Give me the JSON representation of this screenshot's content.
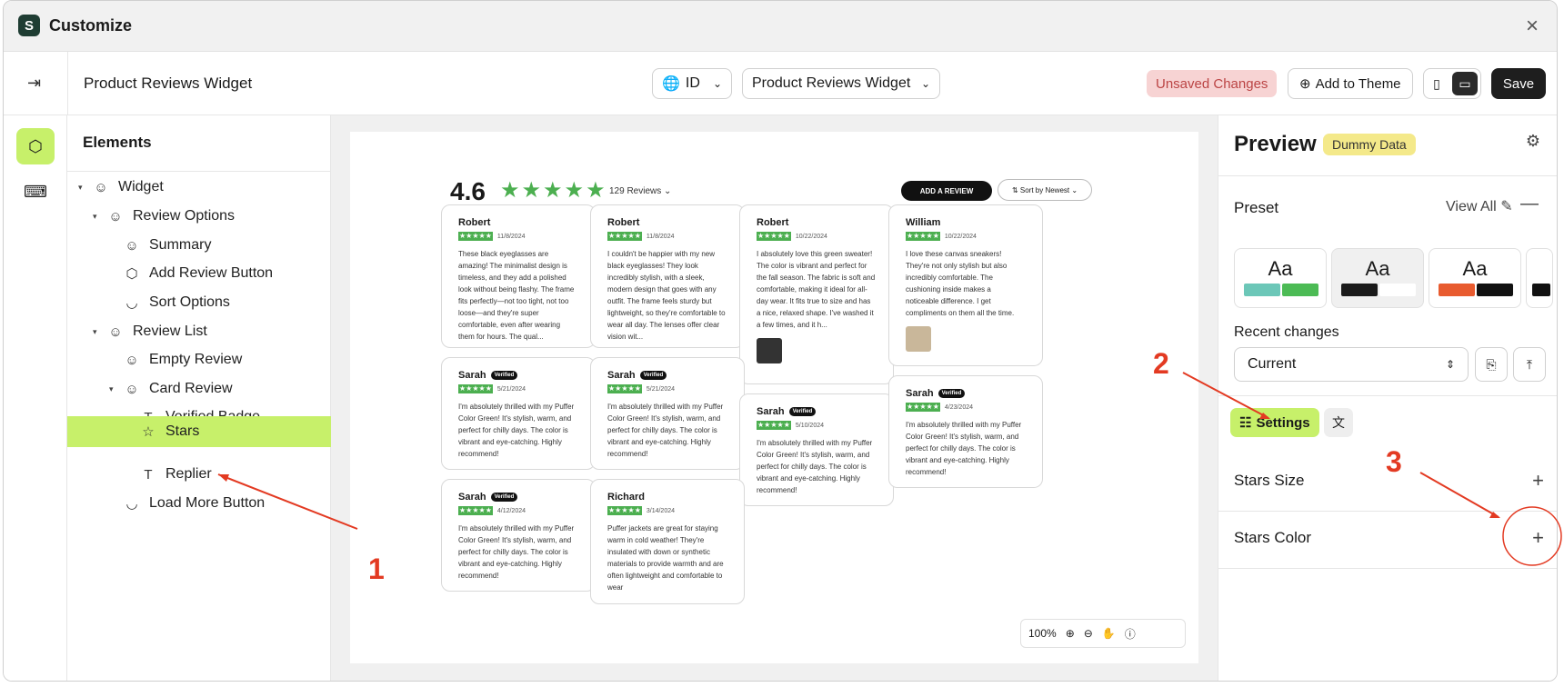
{
  "window": {
    "title": "Customize",
    "close_glyph": "×"
  },
  "topbar": {
    "page_name": "Product Reviews Widget",
    "language": "ID",
    "widget_select": "Product Reviews Widget",
    "unsaved": "Unsaved Changes",
    "add_to_theme": "Add to Theme",
    "save": "Save"
  },
  "elements": {
    "heading": "Elements",
    "items": [
      {
        "label": "Widget"
      },
      {
        "label": "Review Options"
      },
      {
        "label": "Summary"
      },
      {
        "label": "Add Review Button"
      },
      {
        "label": "Sort Options"
      },
      {
        "label": "Review List"
      },
      {
        "label": "Empty Review"
      },
      {
        "label": "Card Review"
      },
      {
        "label": "Verified Badge"
      },
      {
        "label": "Stars"
      },
      {
        "label": "Replier"
      },
      {
        "label": "Load More Button"
      }
    ]
  },
  "canvas": {
    "rating": "4.6",
    "review_count": "129 Reviews",
    "add_review": "ADD A REVIEW",
    "sort": "Sort by Newest",
    "verified": "Verified",
    "zoom": "100%",
    "reviews": [
      {
        "name": "Robert",
        "date": "11/8/2024",
        "text": "These black eyeglasses are amazing! The minimalist design is timeless, and they add a polished look without being flashy. The frame fits perfectly—not too tight, not too loose—and they're super comfortable, even after wearing them for hours. The qual..."
      },
      {
        "name": "Robert",
        "date": "11/8/2024",
        "text": "I couldn't be happier with my new black eyeglasses! They look incredibly stylish, with a sleek, modern design that goes with any outfit. The frame feels sturdy but lightweight, so they're comfortable to wear all day. The lenses offer clear vision wit..."
      },
      {
        "name": "Robert",
        "date": "10/22/2024",
        "text": "I absolutely love this green sweater! The color is vibrant and perfect for the fall season. The fabric is soft and comfortable, making it ideal for all-day wear. It fits true to size and has a nice, relaxed shape. I've washed it a few times, and it h..."
      },
      {
        "name": "William",
        "date": "10/22/2024",
        "text": "I love these canvas sneakers! They're not only stylish but also incredibly comfortable. The cushioning inside makes a noticeable difference. I get compliments on them all the time."
      },
      {
        "name": "Sarah",
        "date": "5/21/2024",
        "text": "I'm absolutely thrilled with my Puffer Color Green! It's stylish, warm, and perfect for chilly days. The color is vibrant and eye-catching. Highly recommend!"
      },
      {
        "name": "Sarah",
        "date": "5/21/2024",
        "text": "I'm absolutely thrilled with my Puffer Color Green! It's stylish, warm, and perfect for chilly days. The color is vibrant and eye-catching. Highly recommend!"
      },
      {
        "name": "Sarah",
        "date": "5/10/2024",
        "text": "I'm absolutely thrilled with my Puffer Color Green! It's stylish, warm, and perfect for chilly days. The color is vibrant and eye-catching. Highly recommend!"
      },
      {
        "name": "Sarah",
        "date": "4/23/2024",
        "text": "I'm absolutely thrilled with my Puffer Color Green! It's stylish, warm, and perfect for chilly days. The color is vibrant and eye-catching. Highly recommend!"
      },
      {
        "name": "Sarah",
        "date": "4/12/2024",
        "text": "I'm absolutely thrilled with my Puffer Color Green! It's stylish, warm, and perfect for chilly days. The color is vibrant and eye-catching. Highly recommend!"
      },
      {
        "name": "Richard",
        "date": "3/14/2024",
        "text": "Puffer jackets are great for staying warm in cold weather! They're insulated with down or synthetic materials to provide warmth and are often lightweight and comfortable to wear"
      }
    ]
  },
  "preview": {
    "title": "Preview",
    "badge": "Dummy Data",
    "preset_label": "Preset",
    "view_all": "View All",
    "swatch_label": "Aa",
    "recent_label": "Recent changes",
    "recent_value": "Current",
    "settings_tab": "Settings",
    "rows": [
      {
        "label": "Stars Size"
      },
      {
        "label": "Stars Color"
      }
    ]
  },
  "annotations": [
    "1",
    "2",
    "3"
  ],
  "colors": {
    "accent": "#c7f06a",
    "star": "#4caf50",
    "annotation": "#e33a22"
  }
}
